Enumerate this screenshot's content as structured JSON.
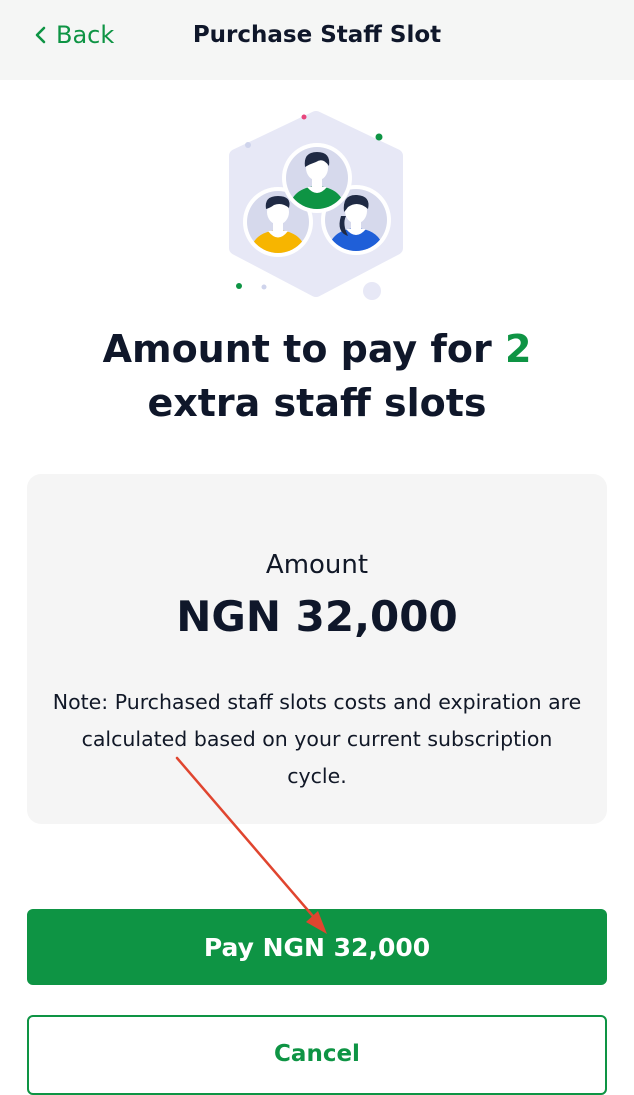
{
  "header": {
    "back_label": "Back",
    "title": "Purchase Staff Slot"
  },
  "heading": {
    "prefix": "Amount to pay for ",
    "count": "2",
    "suffix": "extra staff slots"
  },
  "card": {
    "amount_label": "Amount",
    "amount_value": "NGN 32,000",
    "note": "Note: Purchased staff slots costs and expiration are calculated based on your current subscription cycle."
  },
  "actions": {
    "pay_label": "Pay NGN 32,000",
    "cancel_label": "Cancel"
  },
  "colors": {
    "brand_green": "#0e9444",
    "header_bg": "#f5f6f5",
    "card_bg": "#f5f5f5",
    "annotation_arrow": "#e0452f"
  },
  "icons": {
    "back": "chevron-left-icon",
    "illustration": "staff-group-illustration"
  }
}
